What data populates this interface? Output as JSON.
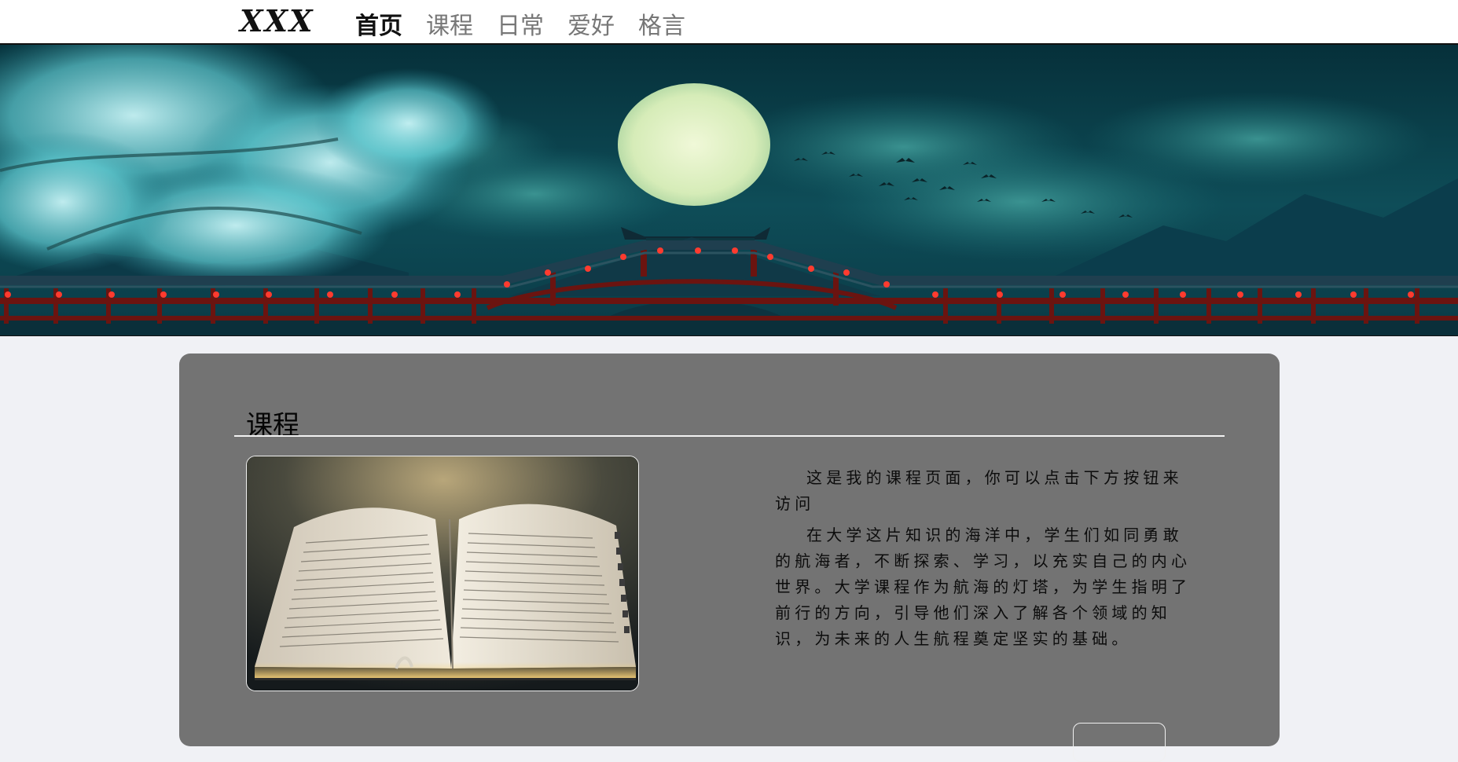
{
  "nav": {
    "logo": "XXX",
    "items": [
      {
        "label": "首页",
        "active": true
      },
      {
        "label": "课程",
        "active": false
      },
      {
        "label": "日常",
        "active": false
      },
      {
        "label": "爱好",
        "active": false
      },
      {
        "label": "格言",
        "active": false
      }
    ]
  },
  "banner": {
    "image": "moonlit-bridge-banner",
    "colors": {
      "sky": "#0e4a55",
      "moon": "#dceec0",
      "bridge": "#6b1410",
      "lantern": "#ff3b2f"
    }
  },
  "course": {
    "title": "课程",
    "image": "open-book-photo",
    "paragraphs": [
      "这是我的课程页面，你可以点击下方按钮来访问",
      "在大学这片知识的海洋中，学生们如同勇敢的航海者，不断探索、学习，以充实自己的内心世界。大学课程作为航海的灯塔，为学生指明了前行的方向，引导他们深入了解各个领域的知识，为未来的人生航程奠定坚实的基础。"
    ],
    "colors": {
      "card": "#737373",
      "rule": "#f2f2f2"
    }
  }
}
